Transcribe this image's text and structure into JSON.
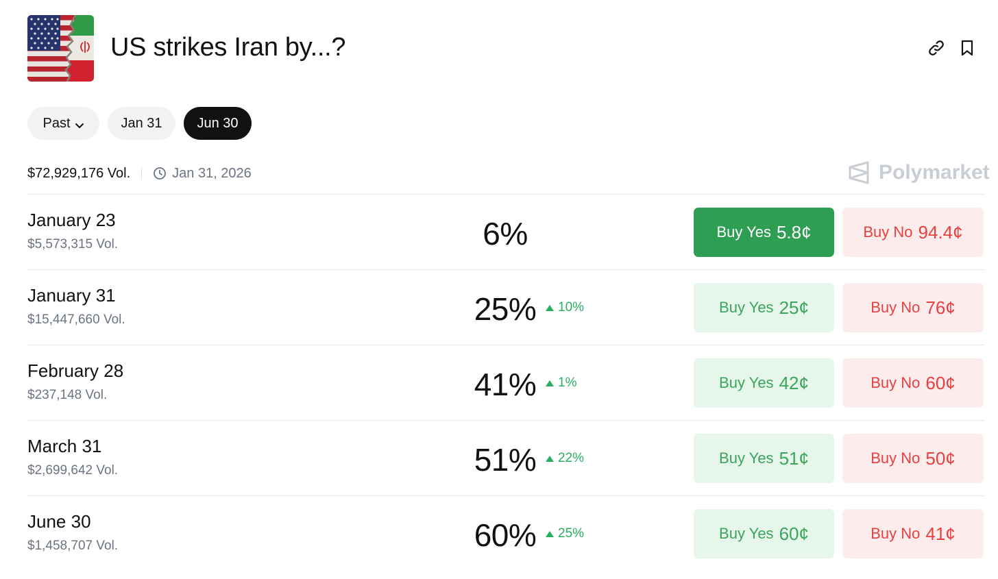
{
  "header": {
    "title": "US strikes Iran by...?",
    "flag_image": "us-iran-flag",
    "icons": [
      "link-icon",
      "bookmark-icon"
    ]
  },
  "filters": [
    {
      "label": "Past",
      "active": false,
      "dropdown": true
    },
    {
      "label": "Jan 31",
      "active": false
    },
    {
      "label": "Jun 30",
      "active": true
    }
  ],
  "meta": {
    "volume": "$72,929,176 Vol.",
    "end_date": "Jan 31, 2026",
    "brand": "Polymarket"
  },
  "colors": {
    "green": "#2e9e52",
    "green_light": "#e6f6ea",
    "red": "#e64040",
    "red_light": "#fdecec"
  },
  "markets": [
    {
      "date": "January 23",
      "volume": "$5,573,315 Vol.",
      "percent": "6%",
      "change": "",
      "yes_label": "Buy Yes",
      "yes_price": "5.8¢",
      "no_label": "Buy No",
      "no_price": "94.4¢",
      "selected": true
    },
    {
      "date": "January 31",
      "volume": "$15,447,660 Vol.",
      "percent": "25%",
      "change": "10%",
      "yes_label": "Buy Yes",
      "yes_price": "25¢",
      "no_label": "Buy No",
      "no_price": "76¢",
      "selected": false
    },
    {
      "date": "February 28",
      "volume": "$237,148 Vol.",
      "percent": "41%",
      "change": "1%",
      "yes_label": "Buy Yes",
      "yes_price": "42¢",
      "no_label": "Buy No",
      "no_price": "60¢",
      "selected": false
    },
    {
      "date": "March 31",
      "volume": "$2,699,642 Vol.",
      "percent": "51%",
      "change": "22%",
      "yes_label": "Buy Yes",
      "yes_price": "51¢",
      "no_label": "Buy No",
      "no_price": "50¢",
      "selected": false
    },
    {
      "date": "June 30",
      "volume": "$1,458,707 Vol.",
      "percent": "60%",
      "change": "25%",
      "yes_label": "Buy Yes",
      "yes_price": "60¢",
      "no_label": "Buy No",
      "no_price": "41¢",
      "selected": false
    }
  ]
}
